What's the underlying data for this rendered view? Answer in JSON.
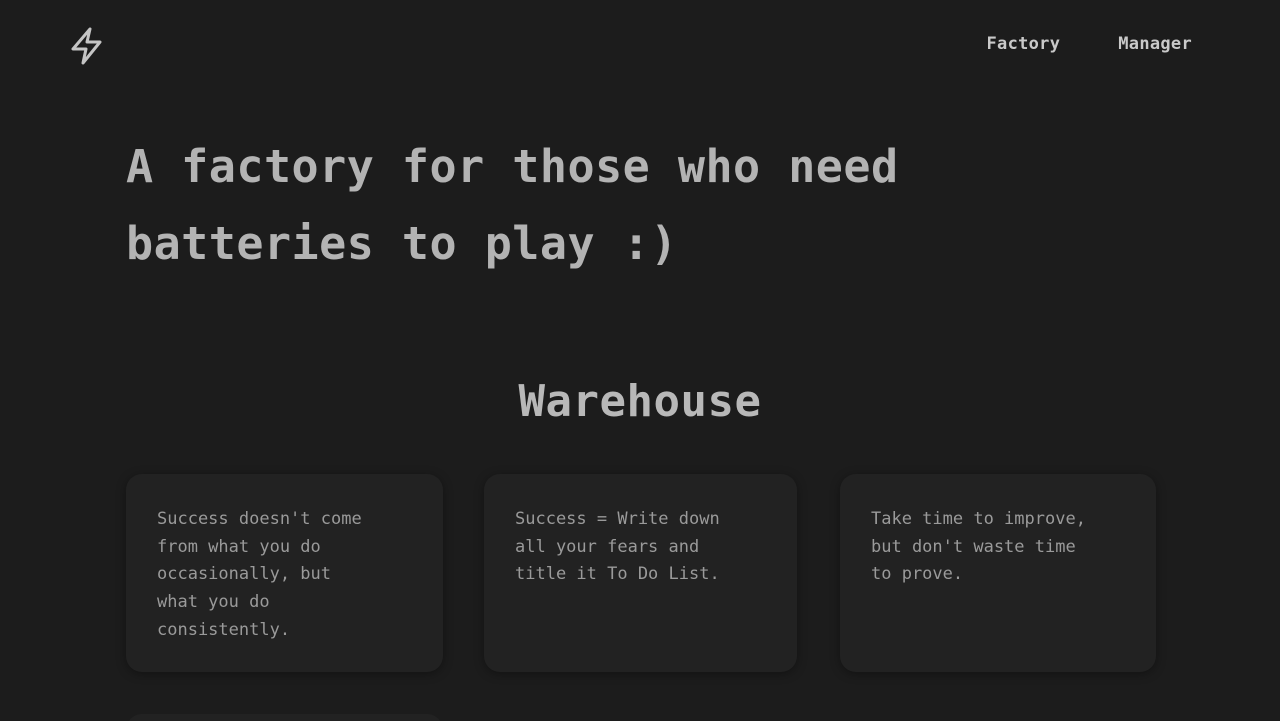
{
  "nav": {
    "logo_icon": "lightning-bolt-icon",
    "links": [
      {
        "label": "Factory"
      },
      {
        "label": "Manager"
      }
    ]
  },
  "hero": {
    "title": "A factory for those who need batteries to play :)"
  },
  "warehouse": {
    "title": "Warehouse",
    "cards": [
      {
        "text": "Success doesn't come\nfrom what you do\noccasionally, but\nwhat you do\nconsistently."
      },
      {
        "text": "Success = Write down\nall your fears and\ntitle it To Do List."
      },
      {
        "text": "Take time to improve,\nbut don't waste time\nto prove."
      }
    ]
  },
  "colors": {
    "background": "#1c1c1c",
    "card": "#222222",
    "heading": "#b3b3b3",
    "body_text": "#9a9a9a"
  }
}
